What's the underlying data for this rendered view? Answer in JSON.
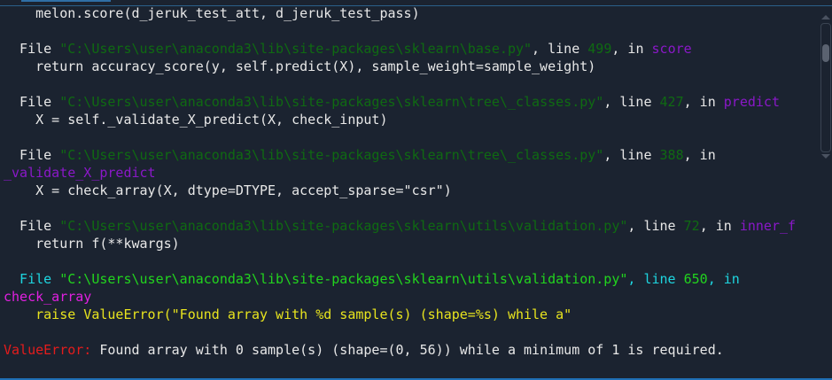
{
  "colors": {
    "default": "#e8e8e8",
    "path": "#0f6a12",
    "func": "#8a18c8",
    "bright_green": "#22d41e",
    "cyan": "#1ed6e0",
    "magenta": "#e020e0",
    "yellow": "#e8e41e",
    "red": "#e41c1c"
  },
  "lines": [
    [
      {
        "t": "    melon.score(d_jeruk_test_att, d_jeruk_test_pass)",
        "c": "default"
      }
    ],
    [],
    [
      {
        "t": "  File ",
        "c": "default"
      },
      {
        "t": "\"C:\\Users\\user\\anaconda3\\lib\\site-packages\\sklearn\\base.py\"",
        "c": "path"
      },
      {
        "t": ", line ",
        "c": "default"
      },
      {
        "t": "499",
        "c": "path"
      },
      {
        "t": ", in ",
        "c": "default"
      },
      {
        "t": "score",
        "c": "func"
      }
    ],
    [
      {
        "t": "    return accuracy_score(y, self.predict(X), sample_weight=sample_weight)",
        "c": "default"
      }
    ],
    [],
    [
      {
        "t": "  File ",
        "c": "default"
      },
      {
        "t": "\"C:\\Users\\user\\anaconda3\\lib\\site-packages\\sklearn\\tree\\_classes.py\"",
        "c": "path"
      },
      {
        "t": ", line ",
        "c": "default"
      },
      {
        "t": "427",
        "c": "path"
      },
      {
        "t": ", in ",
        "c": "default"
      },
      {
        "t": "predict",
        "c": "func"
      }
    ],
    [
      {
        "t": "    X = self._validate_X_predict(X, check_input)",
        "c": "default"
      }
    ],
    [],
    [
      {
        "t": "  File ",
        "c": "default"
      },
      {
        "t": "\"C:\\Users\\user\\anaconda3\\lib\\site-packages\\sklearn\\tree\\_classes.py\"",
        "c": "path"
      },
      {
        "t": ", line ",
        "c": "default"
      },
      {
        "t": "388",
        "c": "path"
      },
      {
        "t": ", in",
        "c": "default"
      }
    ],
    [
      {
        "t": "_validate_X_predict",
        "c": "func"
      }
    ],
    [
      {
        "t": "    X = check_array(X, dtype=DTYPE, accept_sparse=\"csr\")",
        "c": "default"
      }
    ],
    [],
    [
      {
        "t": "  File ",
        "c": "default"
      },
      {
        "t": "\"C:\\Users\\user\\anaconda3\\lib\\site-packages\\sklearn\\utils\\validation.py\"",
        "c": "path"
      },
      {
        "t": ", line ",
        "c": "default"
      },
      {
        "t": "72",
        "c": "path"
      },
      {
        "t": ", in ",
        "c": "default"
      },
      {
        "t": "inner_f",
        "c": "func"
      }
    ],
    [
      {
        "t": "    return f(**kwargs)",
        "c": "default"
      }
    ],
    [],
    [
      {
        "t": "  File ",
        "c": "cyan"
      },
      {
        "t": "\"C:\\Users\\user\\anaconda3\\lib\\site-packages\\sklearn\\utils\\validation.py\"",
        "c": "bright_green"
      },
      {
        "t": ", line ",
        "c": "cyan"
      },
      {
        "t": "650",
        "c": "bright_green"
      },
      {
        "t": ", in",
        "c": "cyan"
      }
    ],
    [
      {
        "t": "check_array",
        "c": "magenta"
      }
    ],
    [
      {
        "t": "    raise ValueError(\"Found array with %d sample(s) (shape=%s) while a\"",
        "c": "yellow"
      }
    ],
    [],
    [
      {
        "t": "ValueError: ",
        "c": "red"
      },
      {
        "t": "Found array with 0 sample(s) (shape=(0, 56)) while a minimum of 1 is required.",
        "c": "default"
      }
    ]
  ]
}
